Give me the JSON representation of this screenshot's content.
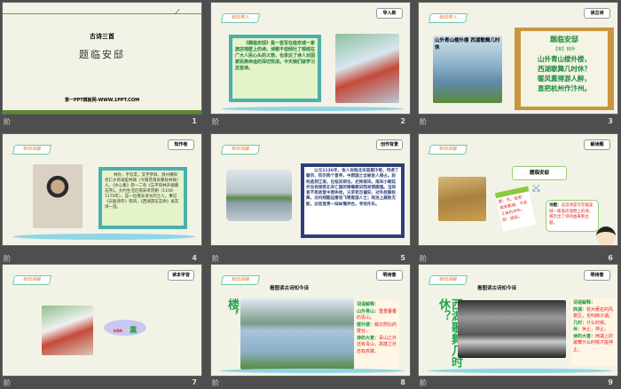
{
  "slides": [
    {
      "number": "1",
      "subtitle": "古诗三首",
      "title": "题临安邸",
      "footer": "第一PPT模板网-WWW.1PPT.COM"
    },
    {
      "number": "2",
      "tag": "新知导入",
      "badge": "导入新",
      "text": "《题临安邸》是一首写在临安城一家旅店墙壁上的诗。诗歌不但倾吐了郁结在广大人民心头的义愤，也表达了诗人对国家民族命运的深切忧虑。今天我们就学习这首诗。"
    },
    {
      "number": "3",
      "tag": "新知导入",
      "badge": "读古诗",
      "image_caption": "山外青山楼外楼 西湖歌舞几时休",
      "poem_title": "题临安邸",
      "author": "【宋】林升",
      "lines": [
        "山外青山楼外楼，",
        "西湖歌舞几时休？",
        "暖风熏得游人醉，",
        "直把杭州作汴州。"
      ]
    },
    {
      "number": "4",
      "tag": "新知讲解",
      "badge": "知作者",
      "text": "林升，字云友，又字梦屏，温州横阳亲仁乡荪湖里林坳（今属苍南县繁枝林坳）人。《水心集》卷一二有《忘平阳林升卿墓志序》。大约生活在南宋孝宗朝（1106-1170年），是一位擅长诗文的士人。事见《东瓯诗存》卷四。《西湖游览志余》录其诗一首。"
    },
    {
      "number": "5",
      "tag": "新知讲解",
      "badge": "创作背景",
      "text": "公元1126年，金人攻陷北宋首都汴梁，俘虏了徽宗、钦宗两个皇帝，中原国土全被金人侵占。赵构逃到江南，在临安即位，史称南宋。南宋小朝廷并没有接受北宋亡国的惨痛教训而发愤图强。当政者不思收复中原失地，只求苟且偏安，对外屈膝投降，对内残酷迫害岳飞等爱国人士；政治上腐败无能，达官显贵一味纵情声色，寻欢作乐。"
    },
    {
      "number": "6",
      "tag": "新知讲解",
      "badge": "解诗题",
      "center": "题临安邸",
      "left_note": "题：写。临安：南宋都城，今浙江省杭州市。邸：旅店。",
      "right_label": "诗题：",
      "right_note": "这首诗是写在临安城一家旅店墙壁上的诗，揭示出了诗的由来和主题。"
    },
    {
      "number": "7",
      "tag": "新知讲解",
      "badge": "读本字音",
      "pinyin": "xūn",
      "char": "熏"
    },
    {
      "number": "8",
      "tag": "新知讲解",
      "badge": "明诗意",
      "heading": "看图读古诗知今译",
      "vertical": "山外青山楼外楼，",
      "notes": [
        {
          "k": "词语解释：",
          "v": ""
        },
        {
          "k": "山外青山：",
          "v": "重重叠叠的青山。"
        },
        {
          "k": "楼外楼：",
          "v": "鳞次栉比的楼台。"
        },
        {
          "k": "诗的大意：",
          "v": "青山之外还有青山，高楼之外还有高楼。"
        }
      ]
    },
    {
      "number": "9",
      "tag": "新知讲解",
      "badge": "明诗意",
      "heading": "看图读古诗知今译",
      "vertical": "西湖歌舞几时休？",
      "notes": [
        {
          "k": "词语解释：",
          "v": ""
        },
        {
          "k": "西湖：",
          "v": "杭州著名的风景区，也叫西子湖。"
        },
        {
          "k": "几时：",
          "v": "什么时候。"
        },
        {
          "k": "休：",
          "v": "休止，停止。"
        },
        {
          "k": "诗的大意：",
          "v": "西湖上的歌舞什么时候才能停止。"
        }
      ]
    }
  ],
  "label_icon": "阶"
}
